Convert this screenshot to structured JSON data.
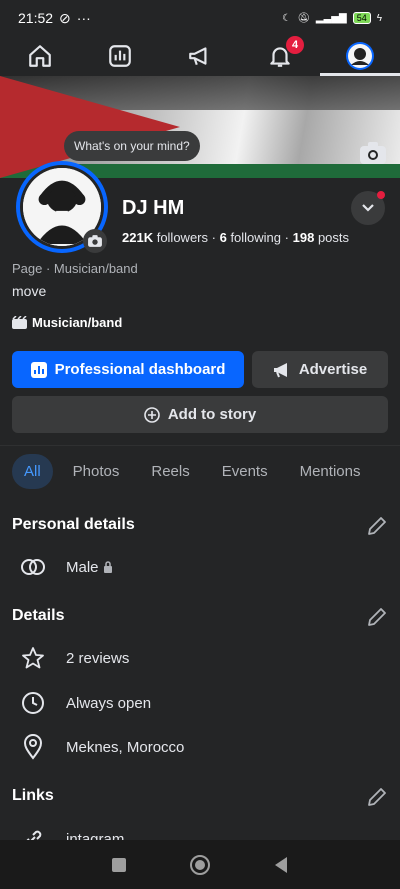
{
  "status_bar": {
    "time": "21:52",
    "battery": "54"
  },
  "nav": {
    "notifications_badge": "4"
  },
  "cover": {
    "prompt": "What's on your mind?"
  },
  "profile": {
    "name": "DJ HM",
    "followers_count": "221K",
    "followers_label": "followers",
    "following_count": "6",
    "following_label": "following",
    "posts_count": "198",
    "posts_label": "posts",
    "category_line": "Page · Musician/band",
    "bio": "move",
    "tag": "Musician/band"
  },
  "actions": {
    "professional_dashboard": "Professional dashboard",
    "advertise": "Advertise",
    "add_to_story": "Add to story"
  },
  "filters": [
    "All",
    "Photos",
    "Reels",
    "Events",
    "Mentions"
  ],
  "personal_details": {
    "title": "Personal details",
    "gender": "Male"
  },
  "details": {
    "title": "Details",
    "reviews": "2 reviews",
    "hours": "Always open",
    "location": "Meknes, Morocco"
  },
  "links": {
    "title": "Links",
    "first_link": "intagram"
  },
  "colors": {
    "accent": "#0866ff",
    "background": "#242526",
    "button_gray": "#3a3b3c",
    "badge": "#e41e3f"
  }
}
